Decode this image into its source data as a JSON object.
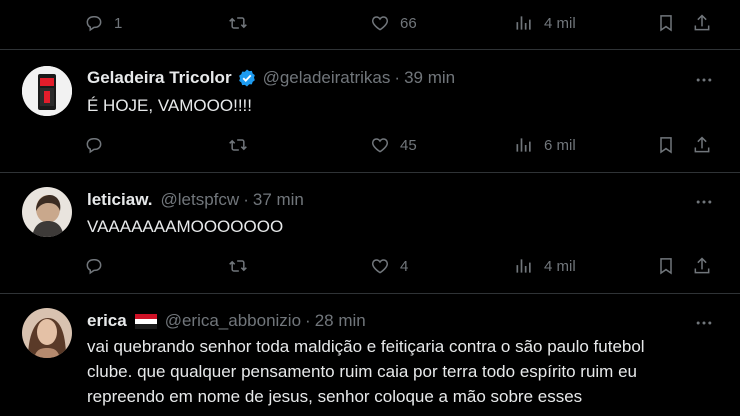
{
  "tweets": [
    {
      "stats": {
        "replies": "1",
        "likes": "66",
        "views": "4 mil"
      }
    },
    {
      "name": "Geladeira Tricolor",
      "handle": "@geladeiratrikas",
      "sep": "·",
      "time": "39 min",
      "text": "É HOJE, VAMOOO!!!!",
      "verified": true,
      "stats": {
        "replies": "",
        "likes": "45",
        "views": "6 mil"
      }
    },
    {
      "name": "leticiaw.",
      "handle": "@letspfcw",
      "sep": "·",
      "time": "37 min",
      "text": "VAAAAAAAMOOOOOOO",
      "stats": {
        "replies": "",
        "likes": "4",
        "views": "4 mil"
      }
    },
    {
      "name": "erica",
      "handle": "@erica_abbonizio",
      "sep": "·",
      "time": "28 min",
      "flag": "red-white-flag",
      "text_lines": [
        "vai quebrando senhor toda maldição e feitiçaria contra o são paulo futebol",
        "clube. que qualquer pensamento ruim caia por terra todo espírito ruim eu",
        "repreendo em nome de jesus, senhor coloque a mão sobre esses"
      ]
    }
  ],
  "colors": {
    "background": "#000000",
    "divider": "#2f3336",
    "muted": "#71767b",
    "text": "#e7e9ea",
    "verified": "#1d9bf0"
  },
  "icons": [
    "reply-icon",
    "retweet-icon",
    "like-icon",
    "views-icon",
    "bookmark-icon",
    "share-icon",
    "more-icon",
    "verified-badge-icon"
  ]
}
